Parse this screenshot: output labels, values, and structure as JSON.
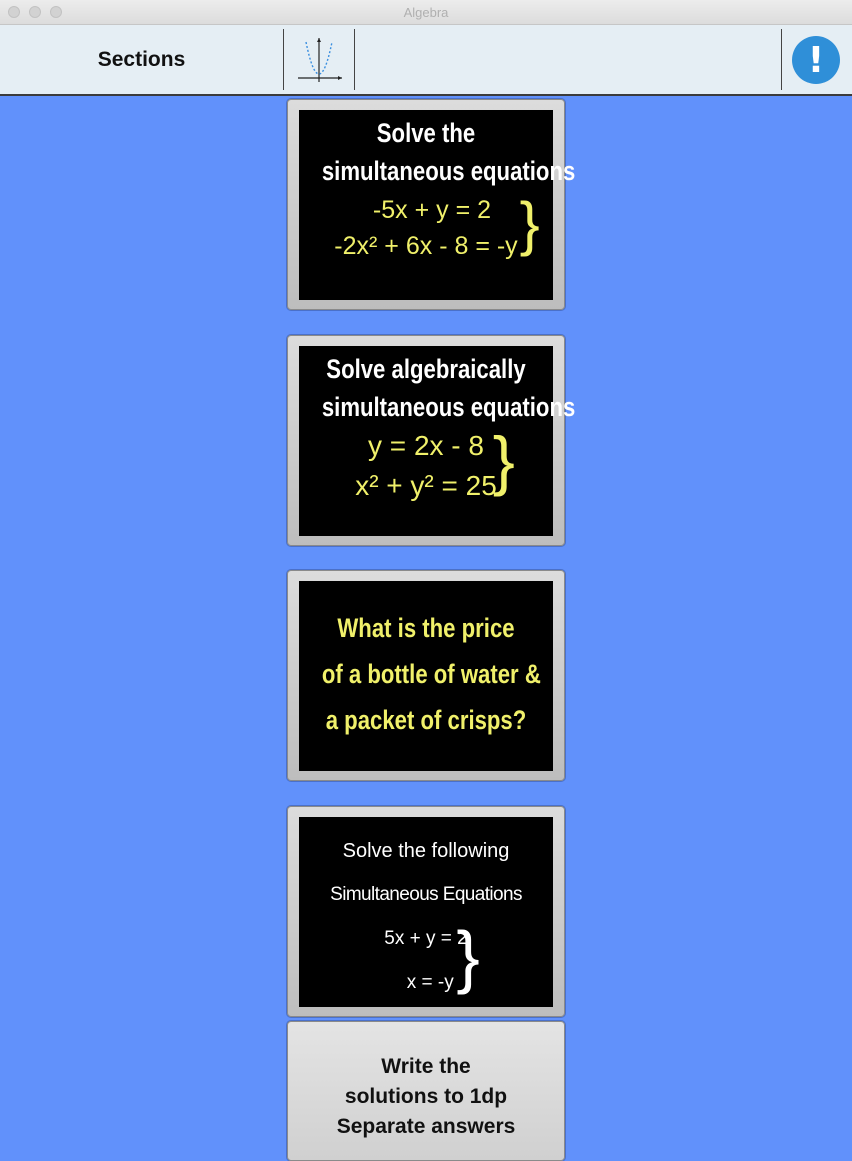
{
  "window": {
    "title": "Algebra"
  },
  "toolbar": {
    "sections_label": "Sections",
    "info_label": "!"
  },
  "cards": [
    {
      "heading": [
        "Solve the",
        "simultaneous equations"
      ],
      "equations": [
        "-5x + y = 2",
        "-2x² + 6x - 8 = -y"
      ]
    },
    {
      "heading": [
        "Solve algebraically",
        "simultaneous equations"
      ],
      "equations": [
        "y = 2x - 8",
        "x² + y² = 25"
      ]
    },
    {
      "lines": [
        "What is the price",
        "of a bottle of water &",
        "a packet of crisps?"
      ]
    },
    {
      "lines": [
        "Solve the following",
        "Simultaneous Equations"
      ],
      "equations": [
        "5x + y = 2",
        "x = -y"
      ]
    },
    {
      "lines": [
        "Write the",
        "solutions to 1dp",
        "Separate answers"
      ]
    }
  ],
  "colors": {
    "background": "#6191fb",
    "accent_yellow": "#f0f06a",
    "info_blue": "#2f8fd8"
  }
}
